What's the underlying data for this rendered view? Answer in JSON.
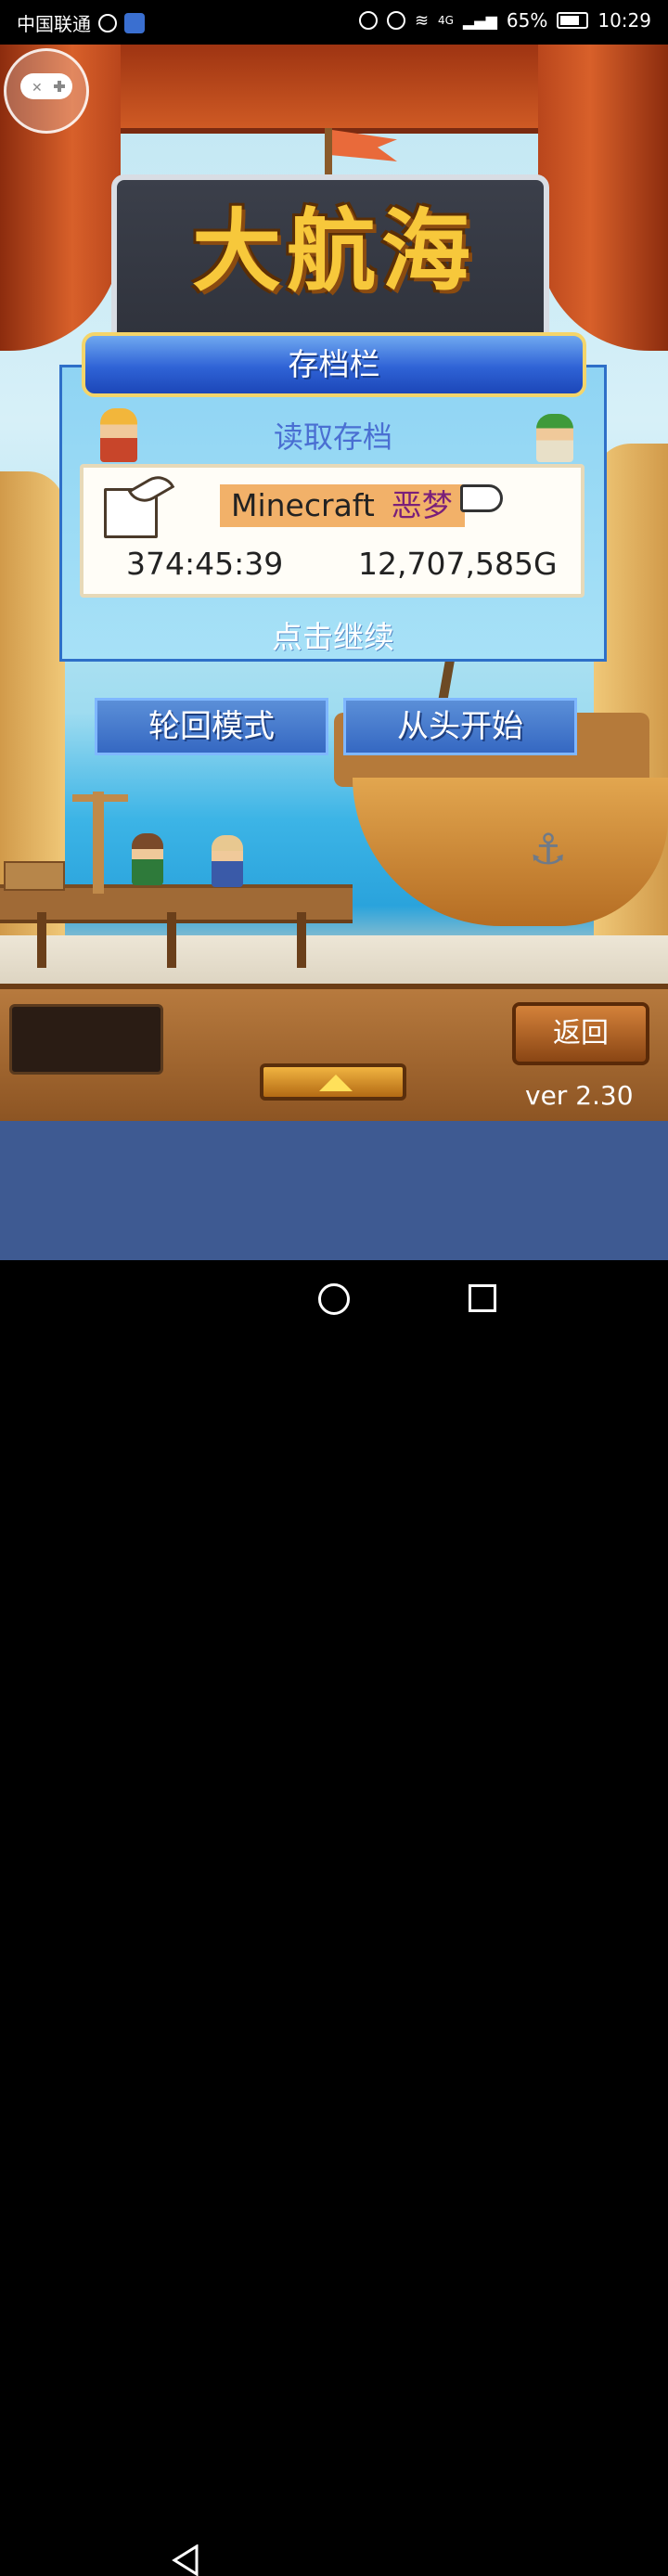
{
  "status_bar": {
    "carrier": "中国联通",
    "signal": "4G",
    "battery": "65%",
    "time": "10:29"
  },
  "game": {
    "logo_text": "大航海",
    "dialog": {
      "title": "存档栏",
      "load_label": "读取存档",
      "save_slot": {
        "name": "Minecraft",
        "difficulty": "恶梦",
        "play_time": "374:45:39",
        "gold": "12,707,585",
        "gold_unit": "G"
      },
      "continue_text": "点击继续"
    },
    "buttons": {
      "rebirth_mode": "轮回模式",
      "new_game": "从头开始",
      "back": "返回"
    },
    "version": "ver 2.30"
  },
  "icons": [
    "gamepad-icon",
    "book-quill-icon",
    "pointing-hand-icon",
    "arrow-up-icon",
    "anchor-icon"
  ],
  "nav_bar": [
    "back-icon",
    "home-icon",
    "recent-apps-icon"
  ]
}
